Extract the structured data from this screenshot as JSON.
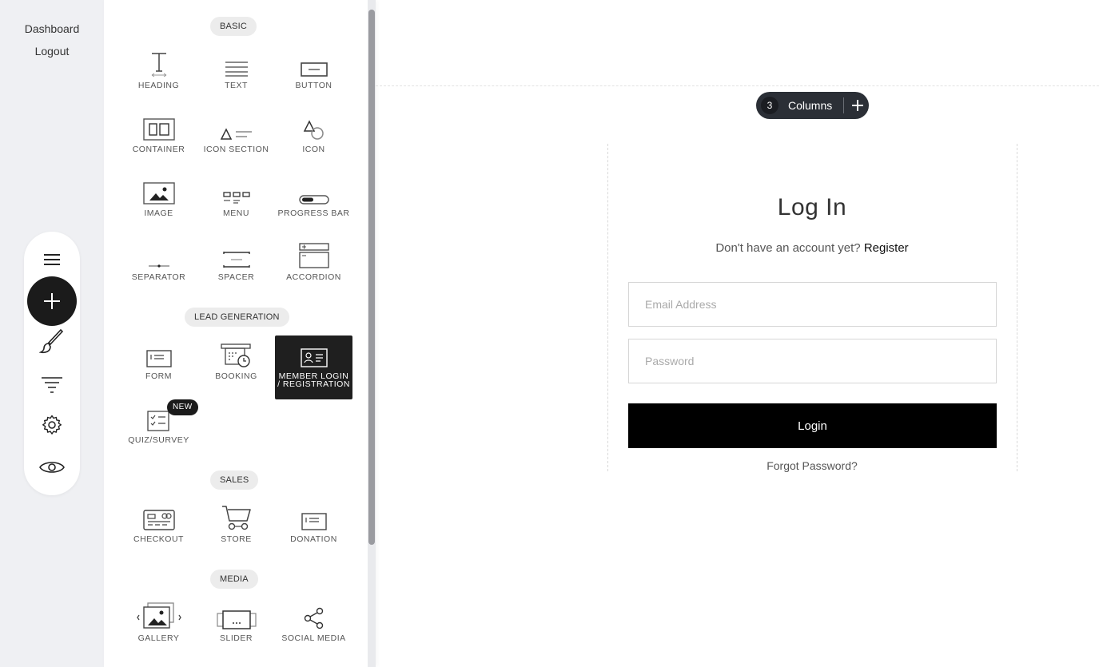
{
  "rail": {
    "dashboard_label": "Dashboard",
    "logout_label": "Logout"
  },
  "toolbar": {
    "icons": [
      "menu-icon",
      "plus-icon",
      "brush-icon",
      "filter-icon",
      "gear-icon",
      "eye-icon"
    ]
  },
  "panel": {
    "sections": {
      "basic": "BASIC",
      "lead": "LEAD GENERATION",
      "sales": "SALES",
      "media": "MEDIA"
    },
    "tiles": {
      "heading": "HEADING",
      "text": "TEXT",
      "button": "BUTTON",
      "container": "CONTAINER",
      "icon_section": "ICON SECTION",
      "icon": "ICON",
      "image": "IMAGE",
      "menu": "MENU",
      "progress_bar": "PROGRESS BAR",
      "separator": "SEPARATOR",
      "spacer": "SPACER",
      "accordion": "ACCORDION",
      "form": "FORM",
      "booking": "BOOKING",
      "member_login": "MEMBER LOGIN / REGISTRATION",
      "quiz": "QUIZ/SURVEY",
      "checkout": "CHECKOUT",
      "store": "STORE",
      "donation": "DONATION",
      "gallery": "GALLERY",
      "slider": "SLIDER",
      "social_media": "SOCIAL MEDIA"
    },
    "new_badge": "NEW",
    "active_tile": "member_login"
  },
  "canvas": {
    "columns": {
      "count": "3",
      "label": "Columns"
    },
    "login": {
      "title": "Log In",
      "subtitle": "Don't have an account yet?",
      "register_link": "Register",
      "email_placeholder": "Email Address",
      "password_placeholder": "Password",
      "login_button": "Login",
      "forgot_link": "Forgot Password?"
    }
  },
  "colors": {
    "rail_bg": "#eff0f3",
    "dark": "#1b1b1b",
    "pill_bg": "#2b2f36",
    "login_button": "#000000"
  }
}
